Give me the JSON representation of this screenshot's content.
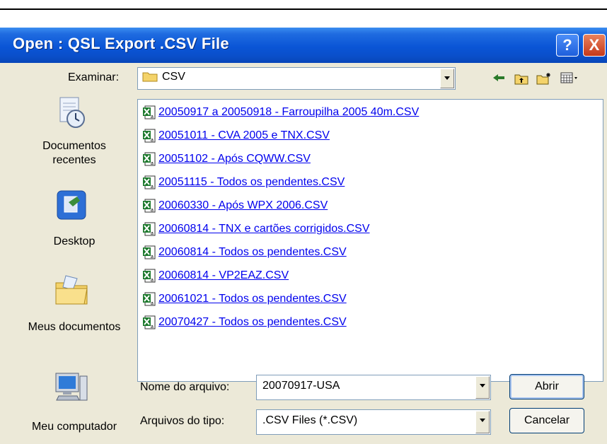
{
  "dialog": {
    "title": "Open : QSL Export .CSV File",
    "help_button": "?",
    "close_button": "X"
  },
  "lookin": {
    "label": "Examinar:",
    "value": "CSV"
  },
  "toolbar": {
    "back_icon": "back-arrow-icon",
    "up_icon": "up-folder-icon",
    "new_folder_icon": "new-folder-icon",
    "view_icon": "view-menu-icon"
  },
  "places": [
    {
      "label": "Documentos recentes",
      "icon": "recent-documents-icon"
    },
    {
      "label": "Desktop",
      "icon": "desktop-icon"
    },
    {
      "label": "Meus documentos",
      "icon": "my-documents-icon"
    },
    {
      "label": "Meu computador",
      "icon": "my-computer-icon"
    }
  ],
  "files": [
    "20050917 a 20050918 - Farroupilha 2005 40m.CSV",
    "20051011 - CVA 2005 e TNX.CSV",
    "20051102 - Após CQWW.CSV",
    "20051115 - Todos os pendentes.CSV",
    "20060330 - Após WPX 2006.CSV",
    "20060814 - TNX e cartões corrigidos.CSV",
    "20060814 - Todos os pendentes.CSV",
    "20060814 - VP2EAZ.CSV",
    "20061021 - Todos os pendentes.CSV",
    "20070427 - Todos os pendentes.CSV"
  ],
  "filename": {
    "label": "Nome do arquivo:",
    "value": "20070917-USA"
  },
  "filetype": {
    "label": "Arquivos do tipo:",
    "value": ".CSV Files (*.CSV)"
  },
  "buttons": {
    "open": "Abrir",
    "cancel": "Cancelar"
  },
  "colors": {
    "title_bar": "#0A55D6",
    "dialog_bg": "#ECE9D8",
    "link": "#0000EE"
  }
}
